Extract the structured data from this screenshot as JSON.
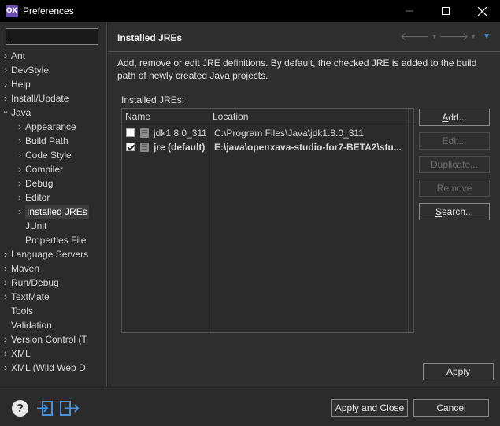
{
  "window": {
    "title": "Preferences",
    "logo_text": "OX"
  },
  "filter": {
    "value": "",
    "placeholder": ""
  },
  "tree": [
    {
      "label": "Ant",
      "level": 0,
      "arrow": "collapsed"
    },
    {
      "label": "DevStyle",
      "level": 0,
      "arrow": "collapsed"
    },
    {
      "label": "Help",
      "level": 0,
      "arrow": "collapsed"
    },
    {
      "label": "Install/Update",
      "level": 0,
      "arrow": "collapsed"
    },
    {
      "label": "Java",
      "level": 0,
      "arrow": "expanded"
    },
    {
      "label": "Appearance",
      "level": 1,
      "arrow": "collapsed"
    },
    {
      "label": "Build Path",
      "level": 1,
      "arrow": "collapsed"
    },
    {
      "label": "Code Style",
      "level": 1,
      "arrow": "collapsed"
    },
    {
      "label": "Compiler",
      "level": 1,
      "arrow": "collapsed"
    },
    {
      "label": "Debug",
      "level": 1,
      "arrow": "collapsed"
    },
    {
      "label": "Editor",
      "level": 1,
      "arrow": "collapsed"
    },
    {
      "label": "Installed JREs",
      "level": 1,
      "arrow": "collapsed",
      "selected": true
    },
    {
      "label": "JUnit",
      "level": 1,
      "arrow": "none"
    },
    {
      "label": "Properties File",
      "level": 1,
      "arrow": "none"
    },
    {
      "label": "Language Servers",
      "level": 0,
      "arrow": "collapsed"
    },
    {
      "label": "Maven",
      "level": 0,
      "arrow": "collapsed"
    },
    {
      "label": "Run/Debug",
      "level": 0,
      "arrow": "collapsed"
    },
    {
      "label": "TextMate",
      "level": 0,
      "arrow": "collapsed"
    },
    {
      "label": "Tools",
      "level": 0,
      "arrow": "none"
    },
    {
      "label": "Validation",
      "level": 0,
      "arrow": "none"
    },
    {
      "label": "Version Control (T",
      "level": 0,
      "arrow": "collapsed"
    },
    {
      "label": "XML",
      "level": 0,
      "arrow": "collapsed"
    },
    {
      "label": "XML (Wild Web D",
      "level": 0,
      "arrow": "collapsed"
    }
  ],
  "page": {
    "title": "Installed JREs",
    "description": "Add, remove or edit JRE definitions. By default, the checked JRE is added to the build path of newly created Java projects.",
    "list_label": "Installed JREs:"
  },
  "table": {
    "headers": {
      "name": "Name",
      "location": "Location"
    },
    "rows": [
      {
        "name": "jdk1.8.0_311",
        "location": "C:\\Program Files\\Java\\jdk1.8.0_311",
        "checked": false,
        "bold": false
      },
      {
        "name": "jre (default)",
        "location": "E:\\java\\openxava-studio-for7-BETA2\\stu...",
        "checked": true,
        "bold": true
      }
    ]
  },
  "buttons": {
    "add": {
      "label": "Add...",
      "enabled": true
    },
    "edit": {
      "label": "Edit...",
      "enabled": false
    },
    "duplicate": {
      "label": "Duplicate...",
      "enabled": false
    },
    "remove": {
      "label": "Remove",
      "enabled": false
    },
    "search": {
      "label": "Search...",
      "enabled": true
    },
    "apply": "Apply",
    "apply_close": "Apply and Close",
    "cancel": "Cancel"
  },
  "colors": {
    "accent": "#4a90d9",
    "background": "#2f2f2f",
    "titlebar": "#000000"
  },
  "icons": {
    "help": "help-icon",
    "import": "import-icon",
    "export": "export-icon"
  }
}
